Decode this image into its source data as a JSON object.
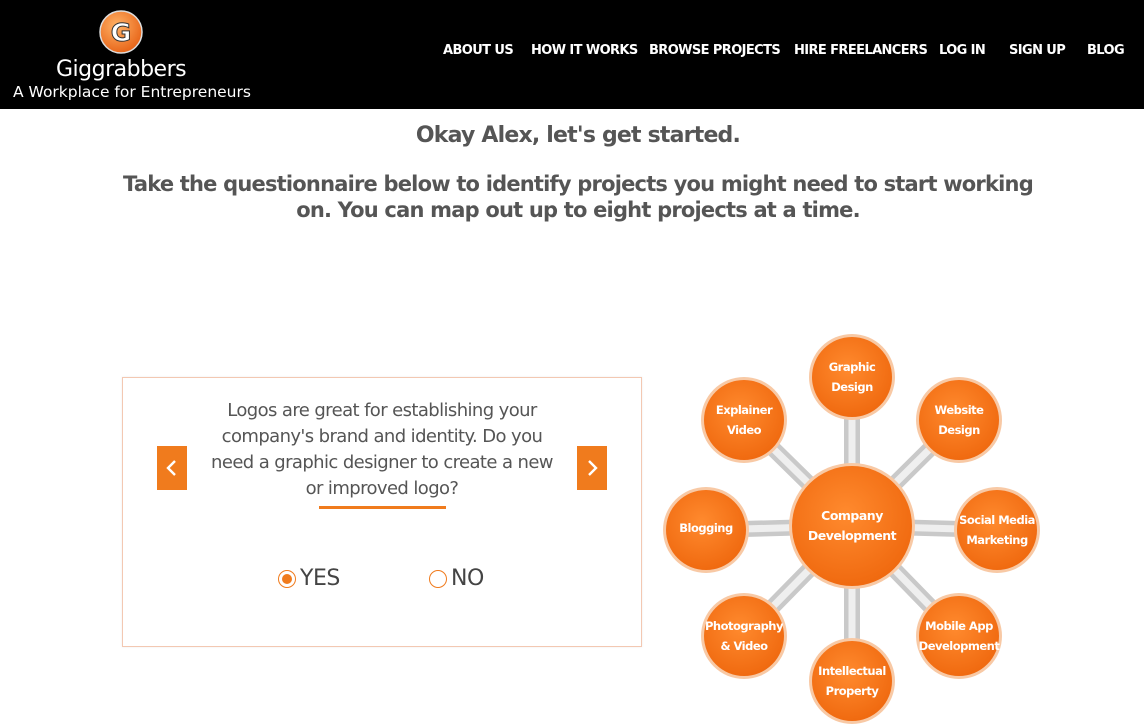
{
  "brand": {
    "name": "Giggrabbers",
    "tagline": "A Workplace for Entrepreneurs",
    "logo_letter": "G",
    "colors": {
      "accent": "#f07b1d",
      "header_bg": "#000000"
    }
  },
  "nav": {
    "items": [
      {
        "label": "ABOUT US"
      },
      {
        "label": "HOW IT WORKS"
      },
      {
        "label": "BROWSE PROJECTS"
      },
      {
        "label": "HIRE FREELANCERS"
      },
      {
        "label": "LOG IN"
      },
      {
        "label": "SIGN UP"
      },
      {
        "label": "BLOG"
      }
    ]
  },
  "intro": {
    "greeting": "Okay Alex, let's get started.",
    "instructions": "Take the questionnaire below to identify projects you might need to start working on. You can map out up to eight projects at a time."
  },
  "questionnaire": {
    "question": "Logos are great for establishing your company's brand and identity. Do you need a graphic designer to create a new or improved logo?",
    "options": [
      {
        "label": "YES",
        "selected": true
      },
      {
        "label": "NO",
        "selected": false
      }
    ],
    "prev_icon": "chevron-left-icon",
    "next_icon": "chevron-right-icon"
  },
  "diagram": {
    "center": {
      "line1": "Company",
      "line2": "Development"
    },
    "nodes": [
      {
        "line1": "Graphic",
        "line2": "Design"
      },
      {
        "line1": "Website",
        "line2": "Design"
      },
      {
        "line1": "Social Media",
        "line2": "Marketing"
      },
      {
        "line1": "Mobile App",
        "line2": "Development"
      },
      {
        "line1": "Intellectual",
        "line2": "Property"
      },
      {
        "line1": "Photography",
        "line2": "& Video"
      },
      {
        "line1": "Blogging",
        "line2": ""
      },
      {
        "line1": "Explainer",
        "line2": "Video"
      }
    ]
  }
}
